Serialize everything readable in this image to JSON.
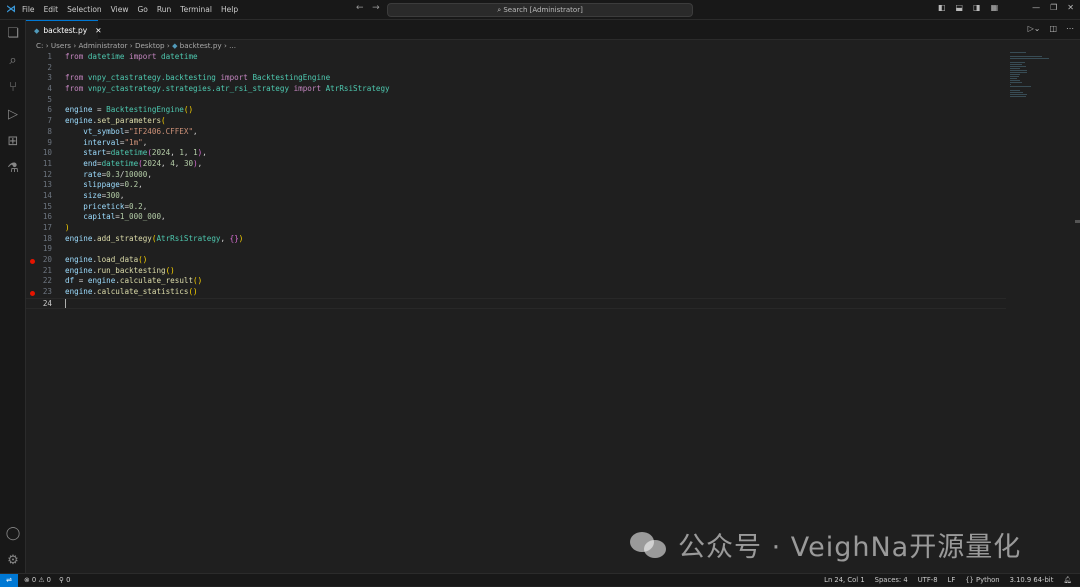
{
  "menu": [
    "File",
    "Edit",
    "Selection",
    "View",
    "Go",
    "Run",
    "Terminal",
    "Help"
  ],
  "search_placeholder": "Search [Administrator]",
  "tab": {
    "label": "backtest.py"
  },
  "breadcrumb": [
    "C:",
    "Users",
    "Administrator",
    "Desktop",
    "backtest.py",
    "..."
  ],
  "lines": [
    [
      [
        "from ",
        "kw"
      ],
      [
        "datetime ",
        "mod"
      ],
      [
        "import ",
        "kw"
      ],
      [
        "datetime",
        "cls"
      ]
    ],
    [],
    [
      [
        "from ",
        "kw"
      ],
      [
        "vnpy_ctastrategy.backtesting ",
        "mod"
      ],
      [
        "import ",
        "kw"
      ],
      [
        "BacktestingEngine",
        "cls"
      ]
    ],
    [
      [
        "from ",
        "kw"
      ],
      [
        "vnpy_ctastrategy.strategies.atr_rsi_strategy ",
        "mod"
      ],
      [
        "import ",
        "kw"
      ],
      [
        "AtrRsiStrategy",
        "cls"
      ]
    ],
    [],
    [
      [
        "engine",
        "var"
      ],
      [
        " = ",
        "op"
      ],
      [
        "BacktestingEngine",
        "cls"
      ],
      [
        "()",
        "p1"
      ]
    ],
    [
      [
        "engine",
        "var"
      ],
      [
        ".",
        "op"
      ],
      [
        "set_parameters",
        "fn"
      ],
      [
        "(",
        "p1"
      ]
    ],
    [
      [
        "    vt_symbol",
        "var"
      ],
      [
        "=",
        "op"
      ],
      [
        "\"IF2406.CFFEX\"",
        "str"
      ],
      [
        ",",
        "op"
      ]
    ],
    [
      [
        "    interval",
        "var"
      ],
      [
        "=",
        "op"
      ],
      [
        "\"1m\"",
        "str"
      ],
      [
        ",",
        "op"
      ]
    ],
    [
      [
        "    start",
        "var"
      ],
      [
        "=",
        "op"
      ],
      [
        "datetime",
        "cls"
      ],
      [
        "(",
        "p2"
      ],
      [
        "2024",
        "num2"
      ],
      [
        ", ",
        "op"
      ],
      [
        "1",
        "num2"
      ],
      [
        ", ",
        "op"
      ],
      [
        "1",
        "num2"
      ],
      [
        ")",
        "p2"
      ],
      [
        ",",
        "op"
      ]
    ],
    [
      [
        "    end",
        "var"
      ],
      [
        "=",
        "op"
      ],
      [
        "datetime",
        "cls"
      ],
      [
        "(",
        "p2"
      ],
      [
        "2024",
        "num2"
      ],
      [
        ", ",
        "op"
      ],
      [
        "4",
        "num2"
      ],
      [
        ", ",
        "op"
      ],
      [
        "30",
        "num2"
      ],
      [
        ")",
        "p2"
      ],
      [
        ",",
        "op"
      ]
    ],
    [
      [
        "    rate",
        "var"
      ],
      [
        "=",
        "op"
      ],
      [
        "0.3",
        "num2"
      ],
      [
        "/",
        "op"
      ],
      [
        "10000",
        "num2"
      ],
      [
        ",",
        "op"
      ]
    ],
    [
      [
        "    slippage",
        "var"
      ],
      [
        "=",
        "op"
      ],
      [
        "0.2",
        "num2"
      ],
      [
        ",",
        "op"
      ]
    ],
    [
      [
        "    size",
        "var"
      ],
      [
        "=",
        "op"
      ],
      [
        "300",
        "num2"
      ],
      [
        ",",
        "op"
      ]
    ],
    [
      [
        "    pricetick",
        "var"
      ],
      [
        "=",
        "op"
      ],
      [
        "0.2",
        "num2"
      ],
      [
        ",",
        "op"
      ]
    ],
    [
      [
        "    capital",
        "var"
      ],
      [
        "=",
        "op"
      ],
      [
        "1_000_000",
        "num2"
      ],
      [
        ",",
        "op"
      ]
    ],
    [
      [
        ")",
        "p1"
      ]
    ],
    [
      [
        "engine",
        "var"
      ],
      [
        ".",
        "op"
      ],
      [
        "add_strategy",
        "fn"
      ],
      [
        "(",
        "p1"
      ],
      [
        "AtrRsiStrategy",
        "cls"
      ],
      [
        ", ",
        "op"
      ],
      [
        "{}",
        "p2"
      ],
      [
        ")",
        "p1"
      ]
    ],
    [],
    [
      [
        "engine",
        "var"
      ],
      [
        ".",
        "op"
      ],
      [
        "load_data",
        "fn"
      ],
      [
        "()",
        "p1"
      ]
    ],
    [
      [
        "engine",
        "var"
      ],
      [
        ".",
        "op"
      ],
      [
        "run_backtesting",
        "fn"
      ],
      [
        "()",
        "p1"
      ]
    ],
    [
      [
        "df",
        "var"
      ],
      [
        " = ",
        "op"
      ],
      [
        "engine",
        "var"
      ],
      [
        ".",
        "op"
      ],
      [
        "calculate_result",
        "fn"
      ],
      [
        "()",
        "p1"
      ]
    ],
    [
      [
        "engine",
        "var"
      ],
      [
        ".",
        "op"
      ],
      [
        "calculate_statistics",
        "fn"
      ],
      [
        "()",
        "p1"
      ]
    ],
    []
  ],
  "breakpoints": [
    20,
    23
  ],
  "current_line": 24,
  "status": {
    "errors": "0",
    "warnings": "0",
    "ports": "0",
    "position": "Ln 24, Col 1",
    "spaces": "Spaces: 4",
    "encoding": "UTF-8",
    "eol": "LF",
    "language": "Python",
    "interpreter": "3.10.9 64-bit"
  },
  "watermark": "公众号 · VeighNa开源量化"
}
